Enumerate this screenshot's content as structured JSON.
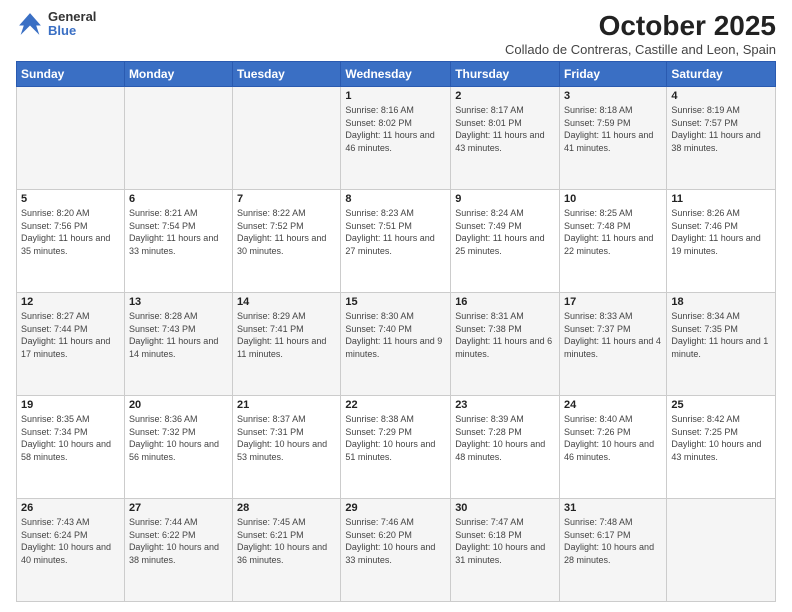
{
  "header": {
    "logo_general": "General",
    "logo_blue": "Blue",
    "month_title": "October 2025",
    "subtitle": "Collado de Contreras, Castille and Leon, Spain"
  },
  "days_of_week": [
    "Sunday",
    "Monday",
    "Tuesday",
    "Wednesday",
    "Thursday",
    "Friday",
    "Saturday"
  ],
  "weeks": [
    [
      {
        "day": "",
        "info": ""
      },
      {
        "day": "",
        "info": ""
      },
      {
        "day": "",
        "info": ""
      },
      {
        "day": "1",
        "info": "Sunrise: 8:16 AM\nSunset: 8:02 PM\nDaylight: 11 hours and 46 minutes."
      },
      {
        "day": "2",
        "info": "Sunrise: 8:17 AM\nSunset: 8:01 PM\nDaylight: 11 hours and 43 minutes."
      },
      {
        "day": "3",
        "info": "Sunrise: 8:18 AM\nSunset: 7:59 PM\nDaylight: 11 hours and 41 minutes."
      },
      {
        "day": "4",
        "info": "Sunrise: 8:19 AM\nSunset: 7:57 PM\nDaylight: 11 hours and 38 minutes."
      }
    ],
    [
      {
        "day": "5",
        "info": "Sunrise: 8:20 AM\nSunset: 7:56 PM\nDaylight: 11 hours and 35 minutes."
      },
      {
        "day": "6",
        "info": "Sunrise: 8:21 AM\nSunset: 7:54 PM\nDaylight: 11 hours and 33 minutes."
      },
      {
        "day": "7",
        "info": "Sunrise: 8:22 AM\nSunset: 7:52 PM\nDaylight: 11 hours and 30 minutes."
      },
      {
        "day": "8",
        "info": "Sunrise: 8:23 AM\nSunset: 7:51 PM\nDaylight: 11 hours and 27 minutes."
      },
      {
        "day": "9",
        "info": "Sunrise: 8:24 AM\nSunset: 7:49 PM\nDaylight: 11 hours and 25 minutes."
      },
      {
        "day": "10",
        "info": "Sunrise: 8:25 AM\nSunset: 7:48 PM\nDaylight: 11 hours and 22 minutes."
      },
      {
        "day": "11",
        "info": "Sunrise: 8:26 AM\nSunset: 7:46 PM\nDaylight: 11 hours and 19 minutes."
      }
    ],
    [
      {
        "day": "12",
        "info": "Sunrise: 8:27 AM\nSunset: 7:44 PM\nDaylight: 11 hours and 17 minutes."
      },
      {
        "day": "13",
        "info": "Sunrise: 8:28 AM\nSunset: 7:43 PM\nDaylight: 11 hours and 14 minutes."
      },
      {
        "day": "14",
        "info": "Sunrise: 8:29 AM\nSunset: 7:41 PM\nDaylight: 11 hours and 11 minutes."
      },
      {
        "day": "15",
        "info": "Sunrise: 8:30 AM\nSunset: 7:40 PM\nDaylight: 11 hours and 9 minutes."
      },
      {
        "day": "16",
        "info": "Sunrise: 8:31 AM\nSunset: 7:38 PM\nDaylight: 11 hours and 6 minutes."
      },
      {
        "day": "17",
        "info": "Sunrise: 8:33 AM\nSunset: 7:37 PM\nDaylight: 11 hours and 4 minutes."
      },
      {
        "day": "18",
        "info": "Sunrise: 8:34 AM\nSunset: 7:35 PM\nDaylight: 11 hours and 1 minute."
      }
    ],
    [
      {
        "day": "19",
        "info": "Sunrise: 8:35 AM\nSunset: 7:34 PM\nDaylight: 10 hours and 58 minutes."
      },
      {
        "day": "20",
        "info": "Sunrise: 8:36 AM\nSunset: 7:32 PM\nDaylight: 10 hours and 56 minutes."
      },
      {
        "day": "21",
        "info": "Sunrise: 8:37 AM\nSunset: 7:31 PM\nDaylight: 10 hours and 53 minutes."
      },
      {
        "day": "22",
        "info": "Sunrise: 8:38 AM\nSunset: 7:29 PM\nDaylight: 10 hours and 51 minutes."
      },
      {
        "day": "23",
        "info": "Sunrise: 8:39 AM\nSunset: 7:28 PM\nDaylight: 10 hours and 48 minutes."
      },
      {
        "day": "24",
        "info": "Sunrise: 8:40 AM\nSunset: 7:26 PM\nDaylight: 10 hours and 46 minutes."
      },
      {
        "day": "25",
        "info": "Sunrise: 8:42 AM\nSunset: 7:25 PM\nDaylight: 10 hours and 43 minutes."
      }
    ],
    [
      {
        "day": "26",
        "info": "Sunrise: 7:43 AM\nSunset: 6:24 PM\nDaylight: 10 hours and 40 minutes."
      },
      {
        "day": "27",
        "info": "Sunrise: 7:44 AM\nSunset: 6:22 PM\nDaylight: 10 hours and 38 minutes."
      },
      {
        "day": "28",
        "info": "Sunrise: 7:45 AM\nSunset: 6:21 PM\nDaylight: 10 hours and 36 minutes."
      },
      {
        "day": "29",
        "info": "Sunrise: 7:46 AM\nSunset: 6:20 PM\nDaylight: 10 hours and 33 minutes."
      },
      {
        "day": "30",
        "info": "Sunrise: 7:47 AM\nSunset: 6:18 PM\nDaylight: 10 hours and 31 minutes."
      },
      {
        "day": "31",
        "info": "Sunrise: 7:48 AM\nSunset: 6:17 PM\nDaylight: 10 hours and 28 minutes."
      },
      {
        "day": "",
        "info": ""
      }
    ]
  ]
}
